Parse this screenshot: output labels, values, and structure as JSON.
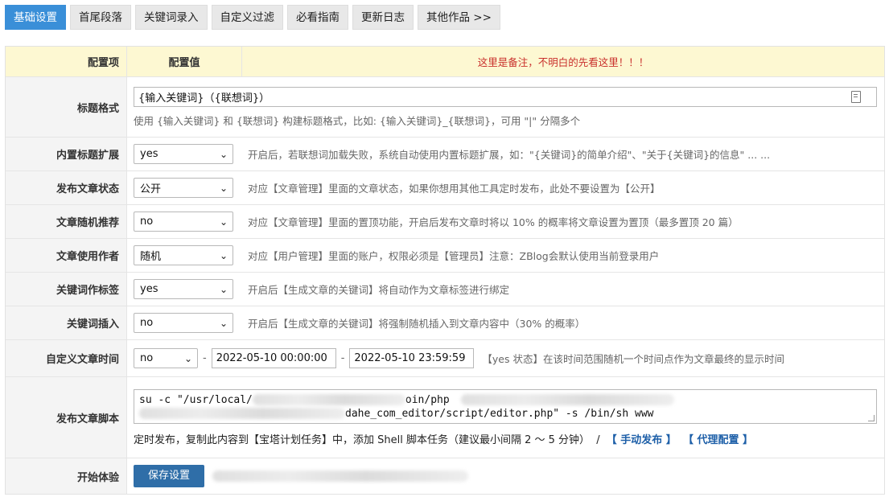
{
  "tabs": [
    {
      "label": "基础设置",
      "active": true
    },
    {
      "label": "首尾段落"
    },
    {
      "label": "关键词录入"
    },
    {
      "label": "自定义过滤"
    },
    {
      "label": "必看指南"
    },
    {
      "label": "更新日志"
    },
    {
      "label": "其他作品 >>"
    }
  ],
  "header": {
    "col1": "配置项",
    "col2": "配置值",
    "note": "这里是备注，不明白的先看这里！！！"
  },
  "title_format": {
    "label": "标题格式",
    "value": "{输入关键词}（{联想词}）",
    "help": "使用 {输入关键词} 和 {联想词} 构建标题格式，比如: {输入关键词}_{联想词}，可用 \"|\" 分隔多个"
  },
  "rows": [
    {
      "label": "内置标题扩展",
      "value": "yes",
      "desc": "开启后，若联想词加载失败，系统自动使用内置标题扩展，如：\"{关键词}的简单介绍\"、\"关于{关键词}的信息\" ... ..."
    },
    {
      "label": "发布文章状态",
      "value": "公开",
      "desc": "对应【文章管理】里面的文章状态，如果你想用其他工具定时发布，此处不要设置为【公开】"
    },
    {
      "label": "文章随机推荐",
      "value": "no",
      "desc": "对应【文章管理】里面的置顶功能，开启后发布文章时将以 10% 的概率将文章设置为置顶（最多置顶 20 篇）"
    },
    {
      "label": "文章使用作者",
      "value": "随机",
      "desc": "对应【用户管理】里面的账户，权限必须是【管理员】注意：ZBlog会默认使用当前登录用户"
    },
    {
      "label": "关键词作标签",
      "value": "yes",
      "desc": "开启后【生成文章的关键词】将自动作为文章标签进行绑定"
    },
    {
      "label": "关键词插入",
      "value": "no",
      "desc": "开启后【生成文章的关键词】将强制随机插入到文章内容中（30% 的概率）"
    }
  ],
  "custom_time": {
    "label": "自定义文章时间",
    "value": "no",
    "start": "2022-05-10 00:00:00",
    "end": "2022-05-10 23:59:59",
    "sep": "-",
    "desc": "【yes 状态】在该时间范围随机一个时间点作为文章最终的显示时间"
  },
  "script": {
    "label": "发布文章脚本",
    "line1_a": "su -c \"/usr/local/",
    "line1_b": "oin/php",
    "line2_b": "dahe_com_editor/script/editor.php\" -s /bin/sh www",
    "help": "定时发布，复制此内容到【宝塔计划任务】中，添加 Shell 脚本任务（建议最小间隔 2 ～ 5 分钟）",
    "slash": "/",
    "link_manual": "【 手动发布 】",
    "link_proxy": "【 代理配置 】"
  },
  "start": {
    "label": "开始体验",
    "button": "保存设置"
  },
  "colors": {
    "active_tab": "#3a8fd8",
    "save_button": "#2f6ea8",
    "header_bg": "#fdf8d2",
    "note_red": "#c9302c",
    "link_blue": "#1d5fa8"
  }
}
